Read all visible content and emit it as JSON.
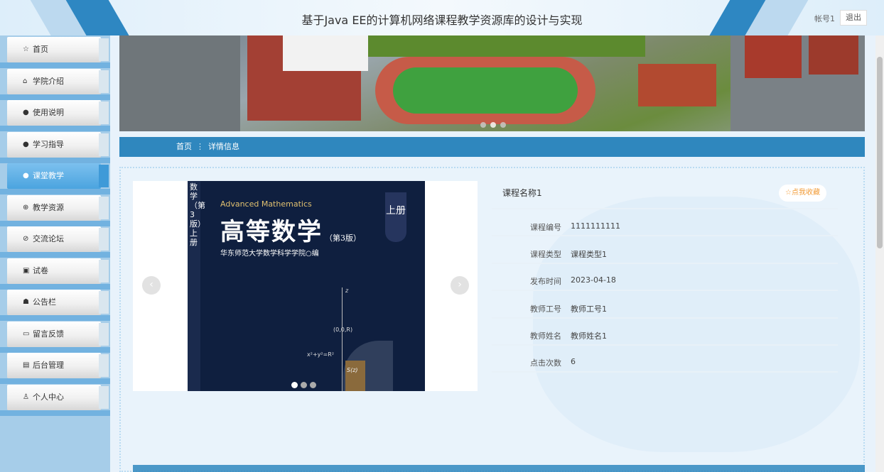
{
  "header": {
    "title": "基于Java EE的计算机网络课程教学资源库的设计与实现",
    "account": "帐号1",
    "logout": "退出"
  },
  "sidebar": {
    "items": [
      {
        "label": "首页",
        "icon": "☆"
      },
      {
        "label": "学院介绍",
        "icon": "⌂"
      },
      {
        "label": "使用说明",
        "icon": "●"
      },
      {
        "label": "学习指导",
        "icon": "●"
      },
      {
        "label": "课堂教学",
        "icon": "●"
      },
      {
        "label": "教学资源",
        "icon": "⊕"
      },
      {
        "label": "交流论坛",
        "icon": "⊘"
      },
      {
        "label": "试卷",
        "icon": "▣"
      },
      {
        "label": "公告栏",
        "icon": "☗"
      },
      {
        "label": "留言反馈",
        "icon": "▭"
      },
      {
        "label": "后台管理",
        "icon": "▤"
      },
      {
        "label": "个人中心",
        "icon": "♙"
      }
    ],
    "active_index": 4
  },
  "breadcrumb": {
    "home": "首页",
    "separator": "⋮",
    "current": "详情信息"
  },
  "book": {
    "spine_text": "数学（第3版）上册",
    "english_title": "Advanced Mathematics",
    "chinese_title": "高等数学",
    "edition": "（第3版）",
    "publisher": "华东师范大学数学科学学院○编",
    "volume": "上册",
    "label_origin": "(0,0,R)",
    "label_eq": "x²+y²=R²",
    "label_s": "S(z)",
    "label_z": "z"
  },
  "gallery": {
    "prev": "‹",
    "next": "›"
  },
  "details": {
    "name": "课程名称1",
    "favorite": "☆点我收藏",
    "fields": [
      {
        "label": "课程编号",
        "value": "1111111111"
      },
      {
        "label": "课程类型",
        "value": "课程类型1"
      },
      {
        "label": "发布时间",
        "value": "2023-04-18"
      },
      {
        "label": "教师工号",
        "value": "教师工号1"
      },
      {
        "label": "教师姓名",
        "value": "教师姓名1"
      },
      {
        "label": "点击次数",
        "value": "6"
      }
    ]
  },
  "colors": {
    "primary": "#2f87be",
    "sidebar": "#a6cde9",
    "active": "#4ba4df",
    "favorite": "#f29c38"
  }
}
